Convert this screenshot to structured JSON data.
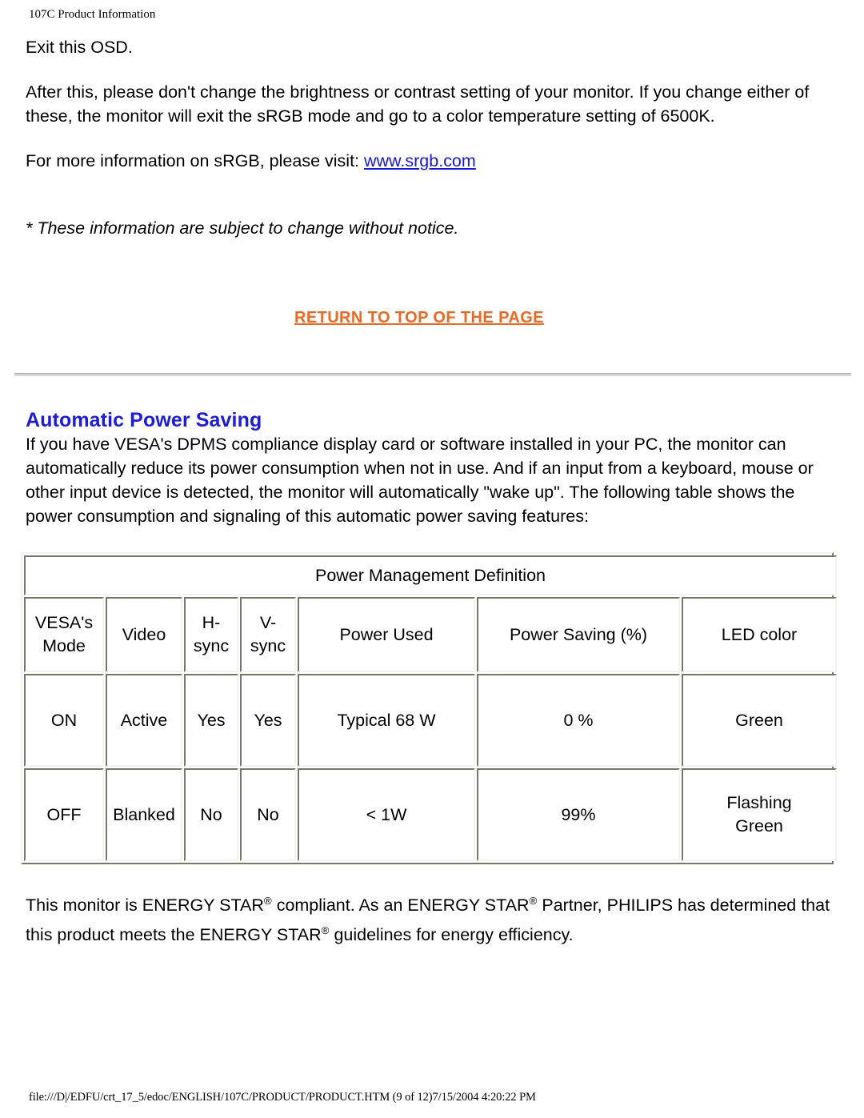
{
  "running_head": "107C Product Information",
  "running_foot": "file:///D|/EDFU/crt_17_5/edoc/ENGLISH/107C/PRODUCT/PRODUCT.HTM (9 of 12)7/15/2004 4:20:22 PM",
  "colors": {
    "link_blue": "#1414ff",
    "heading_blue": "#1a1aec",
    "return_orange": "#f4661b",
    "table_header_blue": "#0033cc",
    "table_border": "#77776a"
  },
  "body": {
    "para_exit": "Exit this OSD.",
    "para_after_this": "After this, please don't change the brightness or contrast setting of your monitor. If you change either of these, the monitor will exit the sRGB mode and go to a color temperature setting of 6500K.",
    "para_more_info_prefix": "For more information on sRGB, please visit:",
    "srgb_link_text": "www.srgb.com",
    "note_italic": "* These information are subject to change without notice.",
    "return_to_top": "RETURN TO TOP OF THE PAGE"
  },
  "section": {
    "heading": "Automatic Power Saving",
    "intro": "If you have VESA's DPMS compliance display card or software installed in your PC, the monitor can automatically reduce its power consumption when not in use. And if an input from a keyboard, mouse or other input device is detected, the monitor will automatically \"wake up\". The following table shows the power consumption and signaling of this automatic power saving features:"
  },
  "table": {
    "title": "Power Management Definition",
    "columns": [
      "VESA's Mode",
      "Video",
      "H-sync",
      "V-sync",
      "Power Used",
      "Power Saving (%)",
      "LED color"
    ],
    "columns_display": [
      {
        "line1": "VESA's",
        "line2": "Mode"
      },
      {
        "line1": "Video",
        "line2": ""
      },
      {
        "line1": "H-",
        "line2": "sync"
      },
      {
        "line1": "V-",
        "line2": "sync"
      },
      {
        "line1": "Power Used",
        "line2": ""
      },
      {
        "line1": "Power Saving (%)",
        "line2": ""
      },
      {
        "line1": "LED color",
        "line2": ""
      }
    ],
    "rows": [
      {
        "mode": "ON",
        "video": "Active",
        "hsync": "Yes",
        "vsync": "Yes",
        "power_used": "Typical 68 W",
        "power_saving": "0 %",
        "led_color_line1": "Green",
        "led_color_line2": ""
      },
      {
        "mode": "OFF",
        "video": "Blanked",
        "hsync": "No",
        "vsync": "No",
        "power_used": "< 1W",
        "power_saving": "99%",
        "led_color_line1": "Flashing",
        "led_color_line2": "Green"
      }
    ]
  },
  "energy_star": {
    "seg1": "This monitor is ENERGY STAR",
    "reg1": "®",
    "seg2": " compliant. As an ENERGY STAR",
    "reg2": "®",
    "seg3": " Partner, PHILIPS has determined that this product meets the ENERGY STAR",
    "reg3": "®",
    "seg4": " guidelines for energy efficiency."
  }
}
